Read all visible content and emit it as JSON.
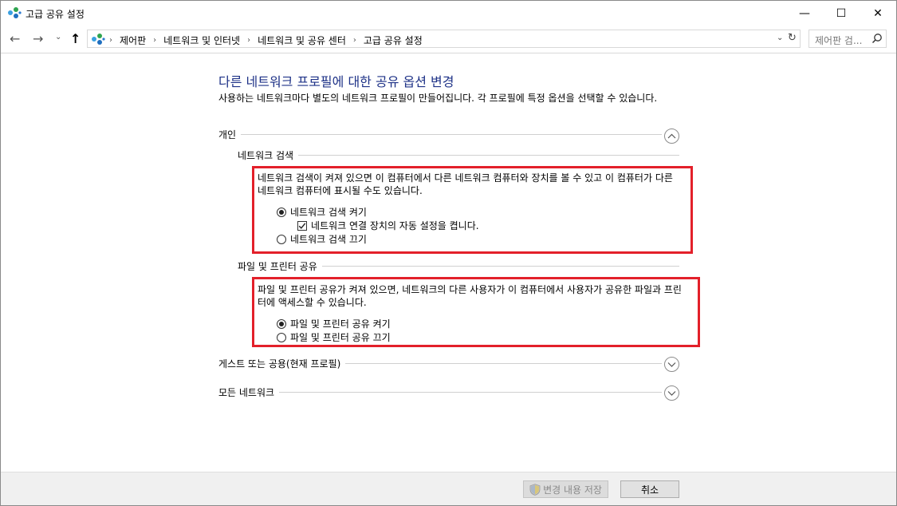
{
  "window": {
    "title": "고급 공유 설정",
    "min_symbol": "—",
    "max_symbol": "☐",
    "close_symbol": "✕"
  },
  "nav": {
    "back_symbol": "←",
    "forward_symbol": "→",
    "recent_symbol": "⌄",
    "up_symbol": "↑",
    "breadcrumbs": [
      "제어판",
      "네트워크 및 인터넷",
      "네트워크 및 공유 센터",
      "고급 공유 설정"
    ],
    "separator": "›",
    "dropdown_symbol": "⌄",
    "refresh_symbol": "↻",
    "search_placeholder": "제어판 검..."
  },
  "main": {
    "title": "다른 네트워크 프로필에 대한 공유 옵션 변경",
    "intro": "사용하는 네트워크마다 별도의 네트워크 프로필이 만들어집니다. 각 프로필에 특정 옵션을 선택할 수 있습니다.",
    "profiles": {
      "private": {
        "label": "개인",
        "expanded": true,
        "network_discovery": {
          "heading": "네트워크 검색",
          "description": "네트워크 검색이 켜져 있으면 이 컴퓨터에서 다른 네트워크 컴퓨터와 장치를 볼 수 있고 이 컴퓨터가 다른 네트워크 컴퓨터에 표시될 수도 있습니다.",
          "on_label": "네트워크 검색 켜기",
          "auto_setup_label": "네트워크 연결 장치의 자동 설정을 켭니다.",
          "auto_setup_checked": true,
          "off_label": "네트워크 검색 끄기",
          "selected": "on"
        },
        "file_printer_sharing": {
          "heading": "파일 및 프린터 공유",
          "description": "파일 및 프린터 공유가 켜져 있으면, 네트워크의 다른 사용자가 이 컴퓨터에서 사용자가 공유한 파일과 프린터에 액세스할 수 있습니다.",
          "on_label": "파일 및 프린터 공유 켜기",
          "off_label": "파일 및 프린터 공유 끄기",
          "selected": "on"
        }
      },
      "guest": {
        "label": "게스트 또는 공용(현재 프로필)",
        "expanded": false
      },
      "all": {
        "label": "모든 네트워크",
        "expanded": false
      }
    }
  },
  "footer": {
    "save_label": "변경 내용 저장",
    "cancel_label": "취소"
  },
  "colors": {
    "title_blue": "#1e3287",
    "highlight_red": "#e3202a"
  }
}
